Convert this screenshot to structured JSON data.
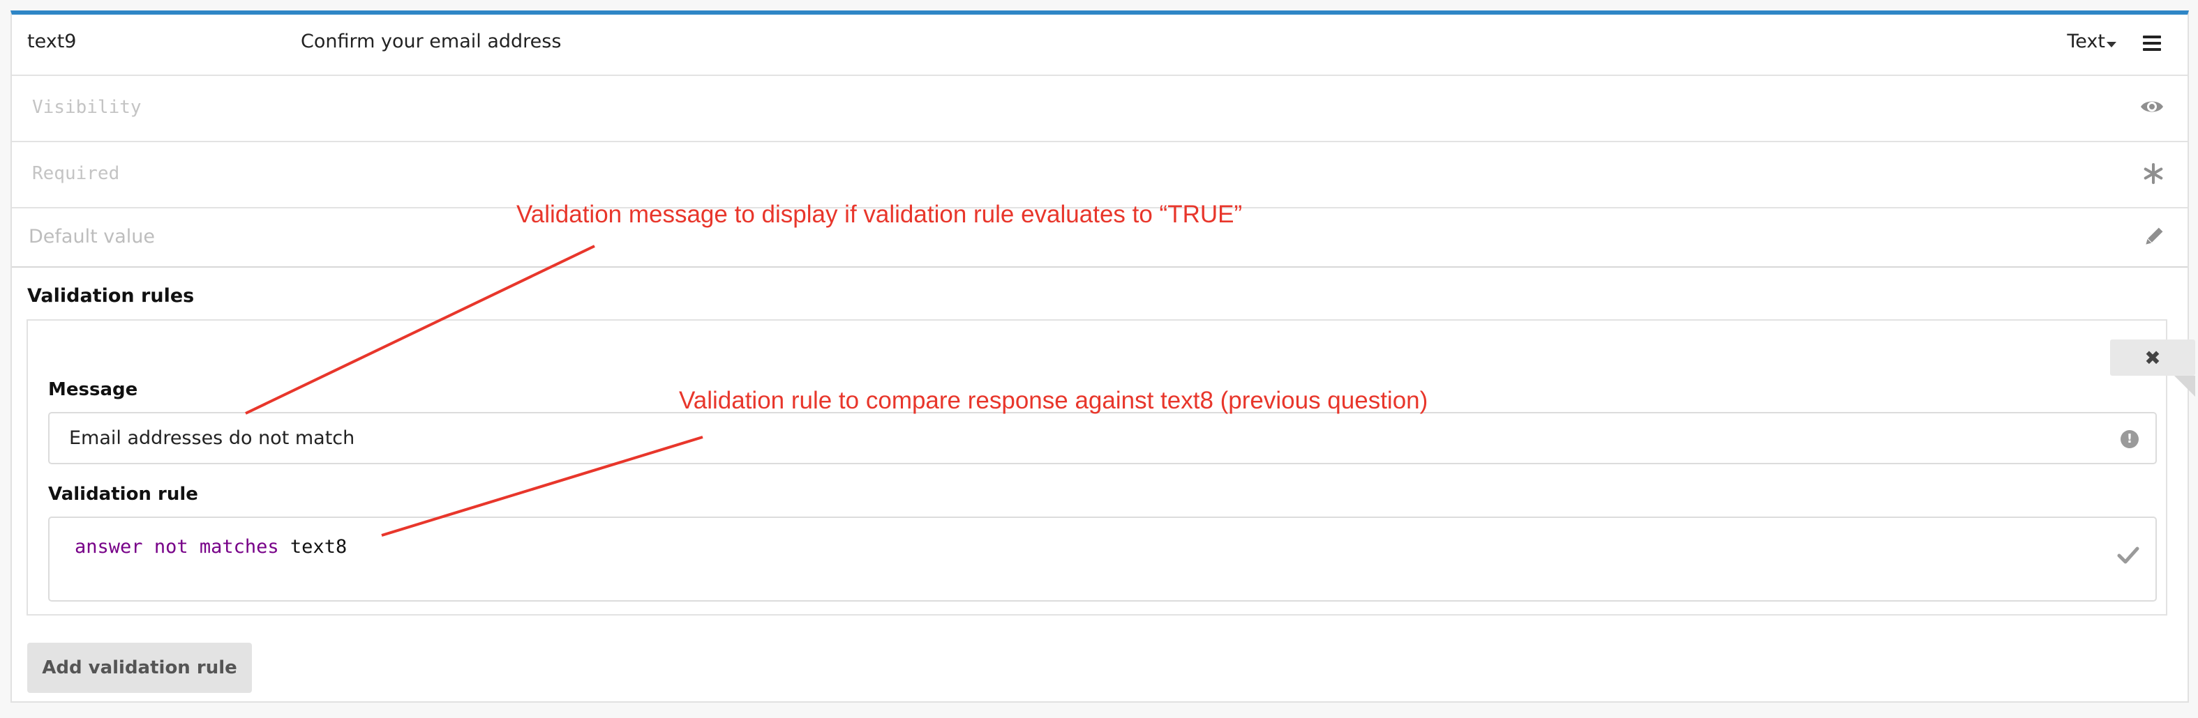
{
  "question": {
    "id": "text9",
    "title": "Confirm your email address",
    "type": "Text"
  },
  "settings": {
    "visibility_placeholder": "Visibility",
    "required_placeholder": "Required",
    "default_value_placeholder": "Default value"
  },
  "validation": {
    "heading": "Validation rules",
    "message_label": "Message",
    "message_value": "Email addresses do not match",
    "rule_label": "Validation rule",
    "rule_tokens": {
      "t1": "answer",
      "t2": "not",
      "t3": "matches",
      "t4": "text8"
    },
    "add_button_label": "Add validation rule",
    "delete_glyph": "✖"
  },
  "annotations": {
    "message_note": "Validation message to display if validation rule evaluates to “TRUE”",
    "rule_note": "Validation rule to compare response against text8 (previous question)"
  },
  "icons": {
    "menu": "hamburger-icon",
    "visibility": "eye-icon",
    "required": "asterisk-icon",
    "default": "pencil-icon",
    "delete": "close-icon",
    "info": "exclamation-circle-icon",
    "valid": "checkmark-icon"
  },
  "colors": {
    "accent": "#2f86c6",
    "annotation": "#e8362b",
    "keyword": "#770088"
  }
}
